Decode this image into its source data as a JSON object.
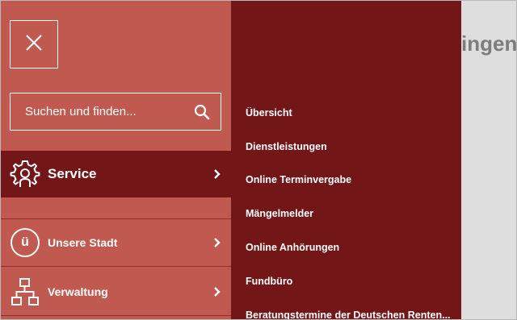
{
  "background": {
    "heading_fragment": "ingen"
  },
  "menu": {
    "close_icon": "close-icon",
    "search": {
      "placeholder": "Suchen und finden...",
      "value": "",
      "icon": "search-icon"
    },
    "items": [
      {
        "label": "Service",
        "icon": "gear-person-icon",
        "active": true
      },
      {
        "label": "Unsere Stadt",
        "icon": "ue",
        "active": false
      },
      {
        "label": "Verwaltung",
        "icon": "org-chart-icon",
        "active": false
      }
    ]
  },
  "submenu": {
    "items": [
      "Übersicht",
      "Dienstleistungen",
      "Online Terminvergabe",
      "Mängelmelder",
      "Online Anhörungen",
      "Fundbüro",
      "Beratungstermine der Deutschen Renten..."
    ]
  },
  "colors": {
    "panel_light": "#c05a50",
    "panel_dark": "#731618",
    "text": "#ffffff"
  }
}
